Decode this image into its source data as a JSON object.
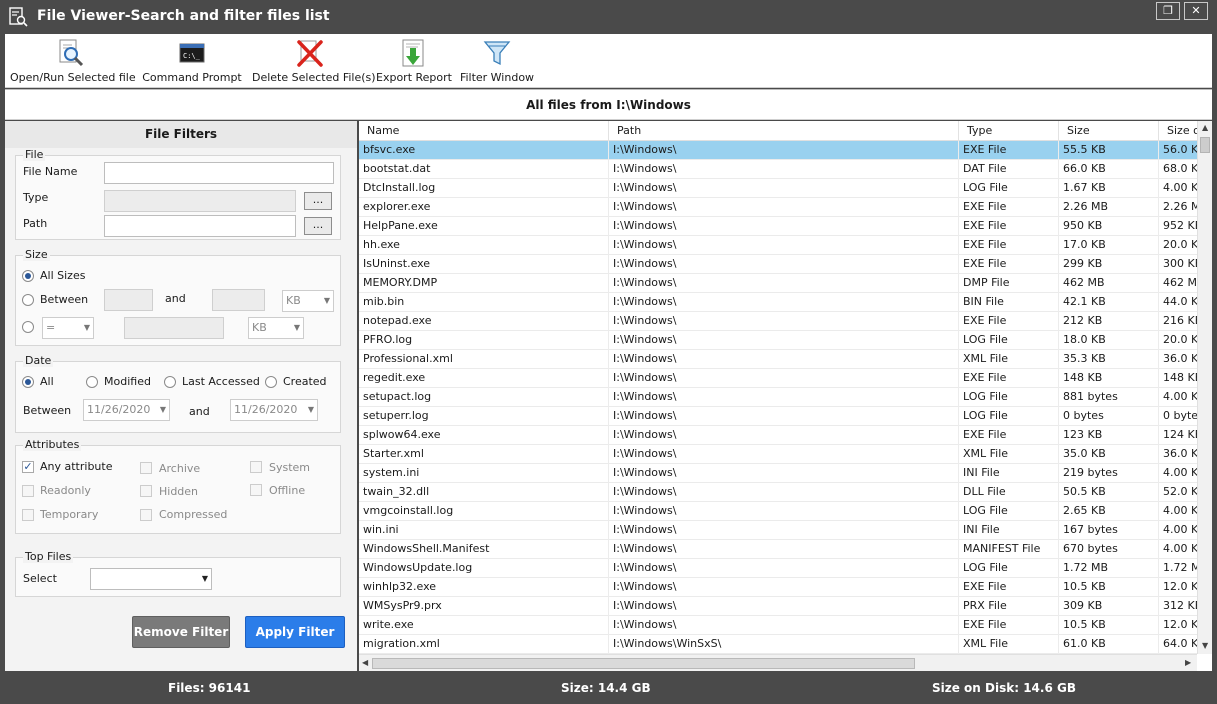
{
  "window": {
    "title": "File Viewer-Search and filter files list",
    "maximize_glyph": "❐",
    "close_glyph": "✕"
  },
  "toolbar": {
    "items": [
      {
        "label": "Open/Run Selected file",
        "icon": "magnifier-icon"
      },
      {
        "label": "Command Prompt",
        "icon": "terminal-icon"
      },
      {
        "label": "Delete Selected File(s)",
        "icon": "delete-x-icon"
      },
      {
        "label": "Export Report",
        "icon": "export-report-icon"
      },
      {
        "label": "Filter Window",
        "icon": "funnel-icon"
      }
    ]
  },
  "banner": "All files from I:\\Windows",
  "filters": {
    "title": "File Filters",
    "file": {
      "group": "File",
      "name_label": "File Name",
      "type_label": "Type",
      "path_label": "Path",
      "browse": "..."
    },
    "size": {
      "group": "Size",
      "all_label": "All Sizes",
      "between_label": "Between",
      "and_label": "and",
      "unit1": "KB",
      "op": "=",
      "unit2": "KB"
    },
    "date": {
      "group": "Date",
      "all": "All",
      "modified": "Modified",
      "accessed": "Last Accessed",
      "created": "Created",
      "between_label": "Between",
      "from": "11/26/2020",
      "and_label": "and",
      "to": "11/26/2020"
    },
    "attributes": {
      "group": "Attributes",
      "any": "Any attribute",
      "archive": "Archive",
      "system": "System",
      "readonly": "Readonly",
      "hidden": "Hidden",
      "offline": "Offline",
      "temporary": "Temporary",
      "compressed": "Compressed"
    },
    "top": {
      "group": "Top Files",
      "select_label": "Select"
    },
    "remove_button": "Remove Filter",
    "apply_button": "Apply Filter"
  },
  "table": {
    "columns": [
      "Name",
      "Path",
      "Type",
      "Size",
      "Size o"
    ],
    "rows": [
      [
        "bfsvc.exe",
        "I:\\Windows\\",
        "EXE File",
        "55.5 KB",
        "56.0 K"
      ],
      [
        "bootstat.dat",
        "I:\\Windows\\",
        "DAT File",
        "66.0 KB",
        "68.0 K"
      ],
      [
        "DtcInstall.log",
        "I:\\Windows\\",
        "LOG File",
        "1.67 KB",
        "4.00 K"
      ],
      [
        "explorer.exe",
        "I:\\Windows\\",
        "EXE File",
        "2.26 MB",
        "2.26 M"
      ],
      [
        "HelpPane.exe",
        "I:\\Windows\\",
        "EXE File",
        "950 KB",
        "952 KE"
      ],
      [
        "hh.exe",
        "I:\\Windows\\",
        "EXE File",
        "17.0 KB",
        "20.0 K"
      ],
      [
        "IsUninst.exe",
        "I:\\Windows\\",
        "EXE File",
        "299 KB",
        "300 KE"
      ],
      [
        "MEMORY.DMP",
        "I:\\Windows\\",
        "DMP File",
        "462 MB",
        "462 M"
      ],
      [
        "mib.bin",
        "I:\\Windows\\",
        "BIN File",
        "42.1 KB",
        "44.0 K"
      ],
      [
        "notepad.exe",
        "I:\\Windows\\",
        "EXE File",
        "212 KB",
        "216 KE"
      ],
      [
        "PFRO.log",
        "I:\\Windows\\",
        "LOG File",
        "18.0 KB",
        "20.0 K"
      ],
      [
        "Professional.xml",
        "I:\\Windows\\",
        "XML File",
        "35.3 KB",
        "36.0 K"
      ],
      [
        "regedit.exe",
        "I:\\Windows\\",
        "EXE File",
        "148 KB",
        "148 KE"
      ],
      [
        "setupact.log",
        "I:\\Windows\\",
        "LOG File",
        "881 bytes",
        "4.00 K"
      ],
      [
        "setuperr.log",
        "I:\\Windows\\",
        "LOG File",
        "0 bytes",
        "0 byte"
      ],
      [
        "splwow64.exe",
        "I:\\Windows\\",
        "EXE File",
        "123 KB",
        "124 KE"
      ],
      [
        "Starter.xml",
        "I:\\Windows\\",
        "XML File",
        "35.0 KB",
        "36.0 K"
      ],
      [
        "system.ini",
        "I:\\Windows\\",
        "INI File",
        "219 bytes",
        "4.00 K"
      ],
      [
        "twain_32.dll",
        "I:\\Windows\\",
        "DLL File",
        "50.5 KB",
        "52.0 K"
      ],
      [
        "vmgcoinstall.log",
        "I:\\Windows\\",
        "LOG File",
        "2.65 KB",
        "4.00 K"
      ],
      [
        "win.ini",
        "I:\\Windows\\",
        "INI File",
        "167 bytes",
        "4.00 K"
      ],
      [
        "WindowsShell.Manifest",
        "I:\\Windows\\",
        "MANIFEST File",
        "670 bytes",
        "4.00 K"
      ],
      [
        "WindowsUpdate.log",
        "I:\\Windows\\",
        "LOG File",
        "1.72 MB",
        "1.72 M"
      ],
      [
        "winhlp32.exe",
        "I:\\Windows\\",
        "EXE File",
        "10.5 KB",
        "12.0 K"
      ],
      [
        "WMSysPr9.prx",
        "I:\\Windows\\",
        "PRX File",
        "309 KB",
        "312 KE"
      ],
      [
        "write.exe",
        "I:\\Windows\\",
        "EXE File",
        "10.5 KB",
        "12.0 K"
      ],
      [
        "migration.xml",
        "I:\\Windows\\WinSxS\\",
        "XML File",
        "61.0 KB",
        "64.0 K"
      ]
    ]
  },
  "status": {
    "files": "Files: 96141",
    "size": "Size: 14.4 GB",
    "disk": "Size on Disk: 14.6 GB"
  },
  "colors": {
    "chrome": "#4a4a4a",
    "selected_row": "#99d1ef",
    "apply_button": "#2b7de9",
    "remove_button": "#7a7a7a"
  }
}
